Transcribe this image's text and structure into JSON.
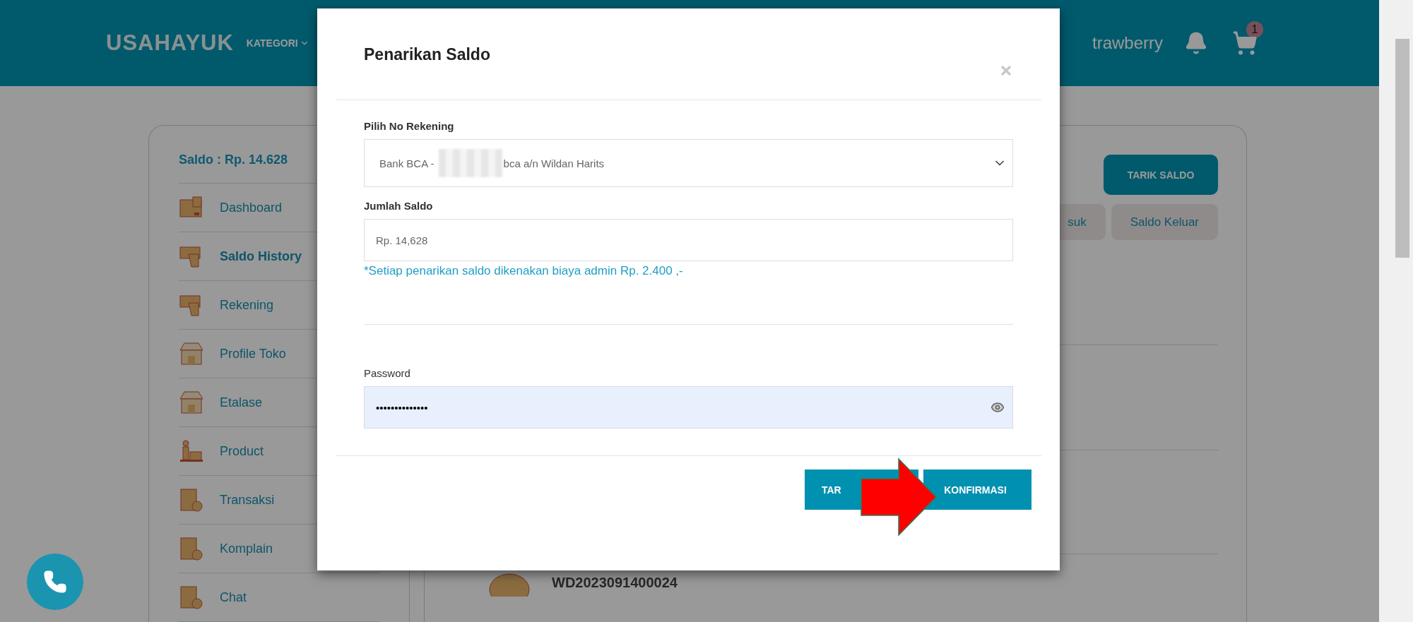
{
  "header": {
    "logo": "USAHAYUK",
    "menu": [
      {
        "label": "KATEGORI"
      }
    ],
    "user_name": "trawberry",
    "cart_count": "1"
  },
  "sidebar": {
    "balance": "Saldo : Rp. 14.628",
    "items": [
      {
        "label": "Dashboard",
        "kind": "box",
        "selected": false
      },
      {
        "label": "Saldo History",
        "kind": "card",
        "selected": true
      },
      {
        "label": "Rekening",
        "kind": "card",
        "selected": false
      },
      {
        "label": "Profile Toko",
        "kind": "store",
        "selected": false
      },
      {
        "label": "Etalase",
        "kind": "store",
        "selected": false
      },
      {
        "label": "Product",
        "kind": "product",
        "selected": false
      },
      {
        "label": "Transaksi",
        "kind": "invoice",
        "selected": false
      },
      {
        "label": "Komplain",
        "kind": "invoice",
        "selected": false
      },
      {
        "label": "Chat",
        "kind": "invoice",
        "selected": false
      }
    ]
  },
  "main": {
    "withdraw_button": "TARIK SALDO",
    "tabs": [
      {
        "label": "suk"
      },
      {
        "label": "Saldo Keluar"
      }
    ],
    "transactions": [
      {
        "id": "WD2023091400024"
      }
    ]
  },
  "dialog": {
    "title": "Penarikan Saldo",
    "account_label": "Pilih No Rekening",
    "account_prefix": "Bank BCA -",
    "account_suffix": "bca a/n Wildan Harits",
    "amount_label": "Jumlah Saldo",
    "amount_value": "Rp. 14,628",
    "note": "*Setiap penarikan saldo dikenakan biaya admin Rp. 2.400 ,-",
    "password_label": "Password",
    "password_value": "••••••••••••••",
    "buttons": [
      {
        "label": "TAR"
      },
      {
        "label": "KONFIRMASI"
      }
    ]
  }
}
